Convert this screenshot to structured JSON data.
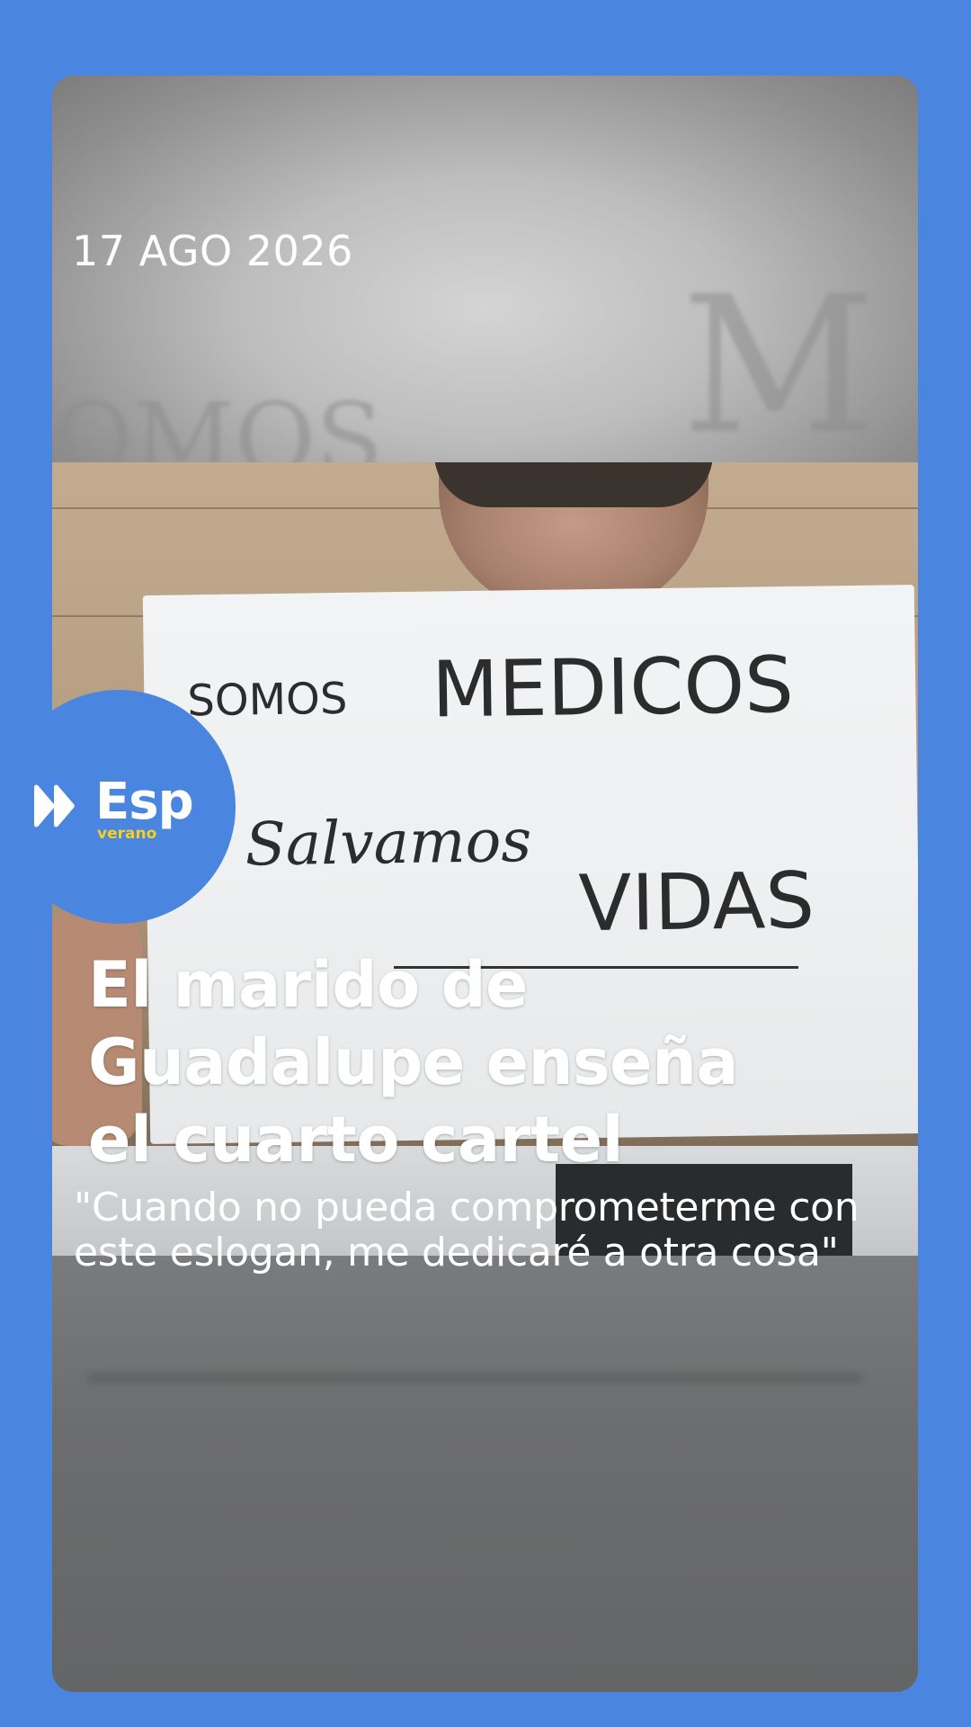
{
  "story": {
    "date": "17 AGO 2026",
    "headline_lines": [
      "El marido de",
      "Guadalupe enseña",
      "el cuarto cartel"
    ],
    "subtitle_lines": [
      "\"Cuando no pueda comprometerme con",
      "este eslogan, me dedicaré a otra cosa\""
    ]
  },
  "sign": {
    "line1_a": "SOMOS",
    "line1_b": "MEDICOS",
    "line2_a": "Salvamos",
    "line2_b": "VIDAS"
  },
  "logo": {
    "name": "Esp",
    "sub": "verano",
    "icon": "fast-forward-icon"
  },
  "colors": {
    "background": "#4a86e0",
    "logo_accent": "#f5d020"
  }
}
